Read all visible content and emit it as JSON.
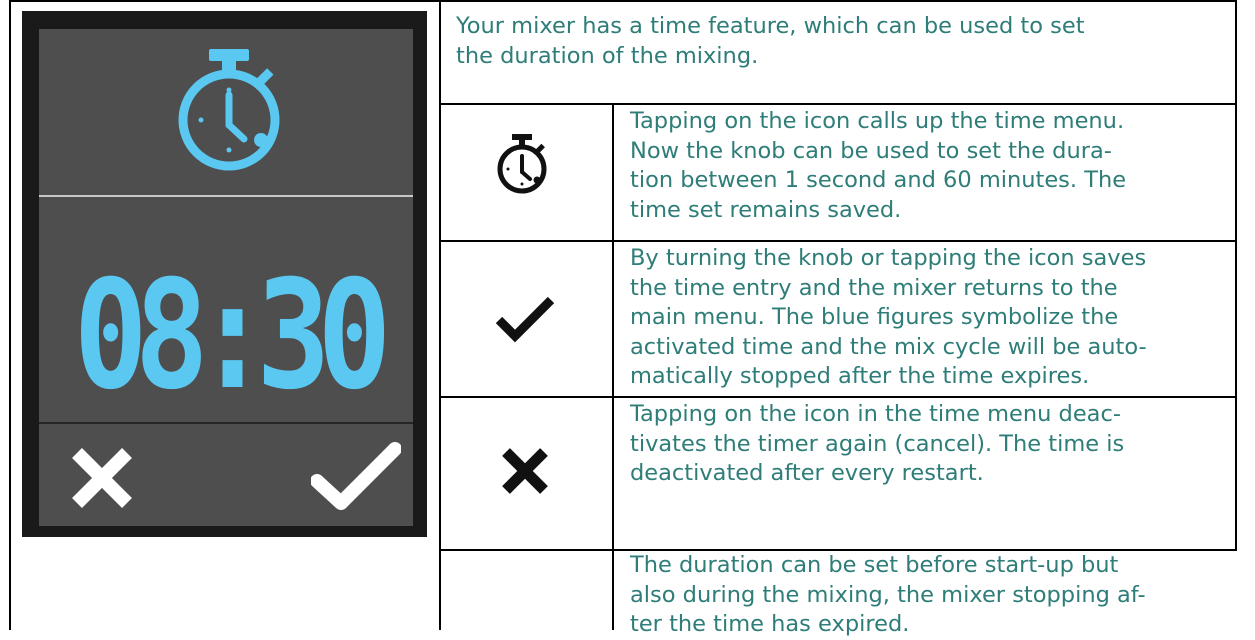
{
  "device": {
    "time_display": "08:30",
    "stopwatch_icon": "stopwatch-icon",
    "cancel_icon": "cancel-icon",
    "confirm_icon": "checkmark-icon",
    "accent_color": "#5bc8f2",
    "screen_color": "#4e4e4e"
  },
  "intro": {
    "text": "Your mixer has a time feature, which can be used to set\nthe duration of the mixing."
  },
  "rows": [
    {
      "icon": "stopwatch-icon",
      "text": "Tapping on the icon calls up the time menu.\nNow the knob can be used to set the dura-\ntion between 1 second and 60 minutes. The\ntime set remains saved."
    },
    {
      "icon": "checkmark-icon",
      "text": "By turning the knob or tapping the icon saves\nthe time entry and the mixer returns to the\nmain menu. The blue figures symbolize the\nactivated time and the mix cycle will be auto-\nmatically stopped after the time expires."
    },
    {
      "icon": "cross-icon",
      "text": "Tapping on the icon in the time menu deac-\ntivates the timer again (cancel). The time is\ndeactivated after every restart."
    },
    {
      "icon": "",
      "text": "The duration can be set before start-up but\nalso during the mixing, the mixer stopping af-\nter the time has expired."
    }
  ],
  "colors": {
    "intro_text": "#2e7d78",
    "row_text": "#2e7d78",
    "icon_color": "#111111"
  }
}
